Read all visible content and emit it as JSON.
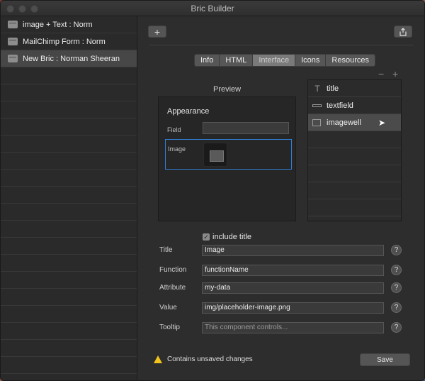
{
  "window": {
    "title": "Bric Builder"
  },
  "sidebar": {
    "items": [
      {
        "label": "image + Text : Norm"
      },
      {
        "label": "MailChimp Form : Norm"
      },
      {
        "label": "New Bric : Norman Sheeran"
      }
    ]
  },
  "toolbar": {
    "add_label": "+",
    "share_label": "⇪"
  },
  "tabs": [
    {
      "label": "Info"
    },
    {
      "label": "HTML"
    },
    {
      "label": "Interface"
    },
    {
      "label": "Icons"
    },
    {
      "label": "Resources"
    }
  ],
  "preview": {
    "label": "Preview",
    "heading": "Appearance",
    "field_label": "Field",
    "image_label": "Image"
  },
  "palette": {
    "minus": "−",
    "plus": "+",
    "items": [
      {
        "label": "title",
        "icon": "text-icon"
      },
      {
        "label": "textfield",
        "icon": "textfield-icon"
      },
      {
        "label": "imagewell",
        "icon": "image-icon"
      }
    ]
  },
  "form": {
    "include_title_label": "include title",
    "include_title_checked": true,
    "fields": [
      {
        "label": "Title",
        "value": "Image",
        "placeholder": ""
      },
      {
        "label": "Function",
        "value": "functionName",
        "placeholder": ""
      },
      {
        "label": "Attribute",
        "value": "my-data",
        "placeholder": ""
      },
      {
        "label": "Value",
        "value": "img/placeholder-image.png",
        "placeholder": ""
      },
      {
        "label": "Tooltip",
        "value": "",
        "placeholder": "This component controls..."
      }
    ],
    "help_label": "?"
  },
  "status": {
    "warning": "Contains unsaved changes"
  },
  "save_label": "Save",
  "colors": {
    "selection_border": "#2f7fd6",
    "warning": "#f0c419",
    "background": "#2d2d2d"
  }
}
